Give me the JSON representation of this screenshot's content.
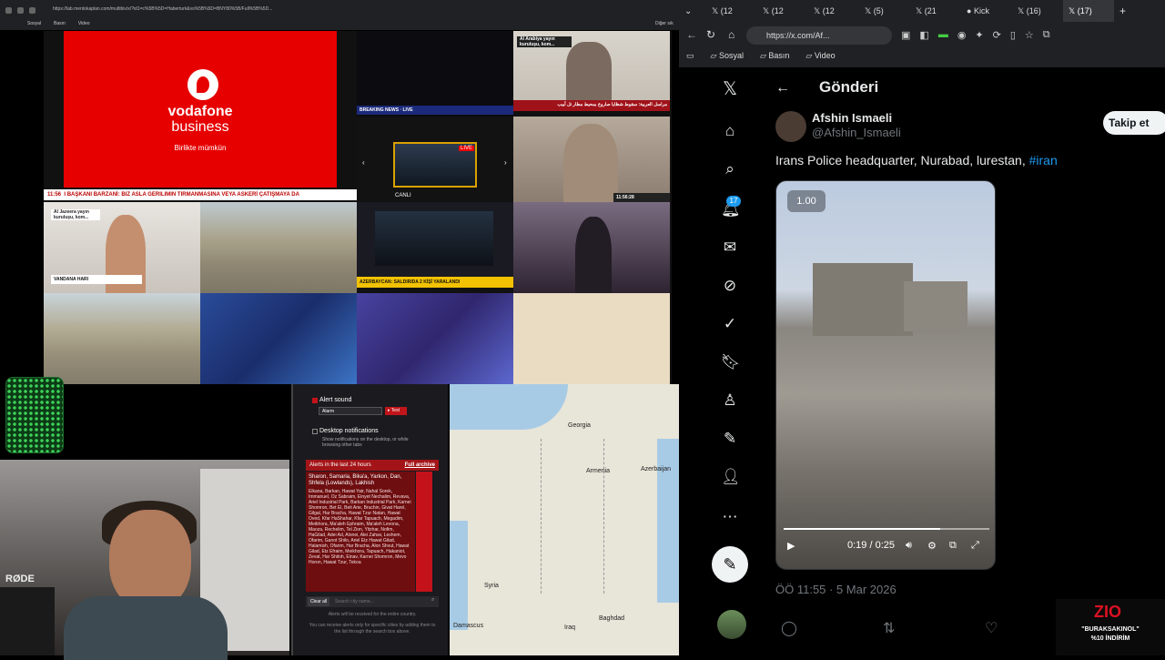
{
  "left_browser": {
    "url": "https://lab.mentokaplan.com/multibiv/x/?id1=c%5B%5D=Haberturk&vs%5B%5D=BNY80%5B/Full%5B%5D...",
    "bookmarks": [
      "Sosyal",
      "Basın",
      "Video"
    ],
    "tab_extra": "Diğer sık"
  },
  "video_wall": {
    "vodafone": {
      "brand": "vodafone",
      "sub": "business",
      "slogan": "Birlikte mümkün"
    },
    "ticker_main": "I BAŞKANI BARZANİ: BIZ ASLA GERILIMIN TIRMANMASINA VEYA ASKERİ ÇATIŞMAYA DA",
    "ticker_time": "11:56",
    "aljazeera_top": "Al Arabiya yayın kuruluşu, kom...",
    "aljazeera_left": "Al Jazeera yayın kuruluşu, kom...",
    "arabic_ticker": "مراسل العربية: سقوط شظايا صاروخ بمحيط مطار تل أبيب",
    "aljazeera_clock": "11:56:28",
    "name_strip": "VANDANA HARI",
    "azerbaycan": "AZERBAYCAN: SALDIRIDA 2 KİŞİ YARALANDI",
    "live": "LIVE",
    "canli": "CANLI"
  },
  "webcam": {
    "mic_brand": "RØDE"
  },
  "alerts_panel": {
    "alert_sound_label": "Alert sound",
    "alert_sound_value": "Alarm",
    "test_label": "▸ Test",
    "desktop_notif_label": "Desktop notifications",
    "desktop_notif_desc": "Show notifications on the desktop, or while browsing other tabs",
    "last24_label": "Alerts in the last 24 hours",
    "full_archive": "Full archive",
    "alert_headline": "Sharon, Samaria, Bika'a, Yarkon, Dan, Shfela (Lowlands), Lakhish",
    "alert_body": "Elkana, Barkan, Hawat Yair, Nahal Sorek, Immanuel, Oz Sabraim, Einyet Nechalim, Revava, Ariel Industrial Park, Barkan Industrial Park, Karnei Shomron, Bet El, Beit Arie, Bruchin, Givat Harel, Gilgal, Har Bracha, Hawat Tzur Natan, Hawat Oved, Kfar HaShahar, Kfar Tapuach, Megadim, Meikhora, Ma'aleh Ephraim, Ma'aleh Levona, Maoza, Rechelim, Tel Zion, Yitzhar, Nofim, HaGilad, Adei Ad, Alonei, Alei Zahav, Leshem, Ofarim, Ganot Shilo, Ariel Etz Hawat Gilad, Halamish, Ofarim, Har Bracha, Alon Shvut, Hawat Gilad, Etz Efraim, Meikhora, Tapuach, Hakaniot, Zevat, Har Shiloh, Einav, Karnei Shomron, Mevo Horon, Hawat Tzur, Tekoa",
    "clear_all": "Clear all",
    "search_placeholder": "Search city name...",
    "footer1": "Alerts will be received for the entire country.",
    "footer2": "You can receive alerts only for specific cities by adding them to the list through the search box above."
  },
  "map": {
    "labels": [
      "Georgia",
      "Armenia",
      "Azerbaijan",
      "Syria",
      "Damascus",
      "Iraq",
      "Baghdad"
    ]
  },
  "right_browser": {
    "tabs": [
      "(12",
      "(12",
      "(12",
      "(5)",
      "(21",
      "Kick",
      "(16)",
      "(17)"
    ],
    "url": "https://x.com/Af...",
    "bookmarks": [
      "Sosyal",
      "Basın",
      "Video"
    ]
  },
  "x_post": {
    "page_title": "Gönderi",
    "author_name": "Afshin Ismaeli",
    "author_handle": "@Afshin_Ismaeli",
    "follow_label": "Takip et",
    "tweet_text": "Irans Police headquarter, Nurabad, lurestan,",
    "hashtag": "#iran",
    "video_speed": "1.00",
    "video_time": "0:19 / 0:25",
    "video_progress": 0.76,
    "post_date": "ÖÖ 11:55 · 5 Mar 2026",
    "notifications_badge": "17"
  },
  "overlay_logo": {
    "brand": "ZIO",
    "line1": "\"BURAKSAKINOL\"",
    "line2": "%10 İNDİRİM"
  },
  "colors": {
    "vodafone_red": "#e60000",
    "x_blue": "#1d9bf0",
    "alert_red": "#a31418"
  }
}
